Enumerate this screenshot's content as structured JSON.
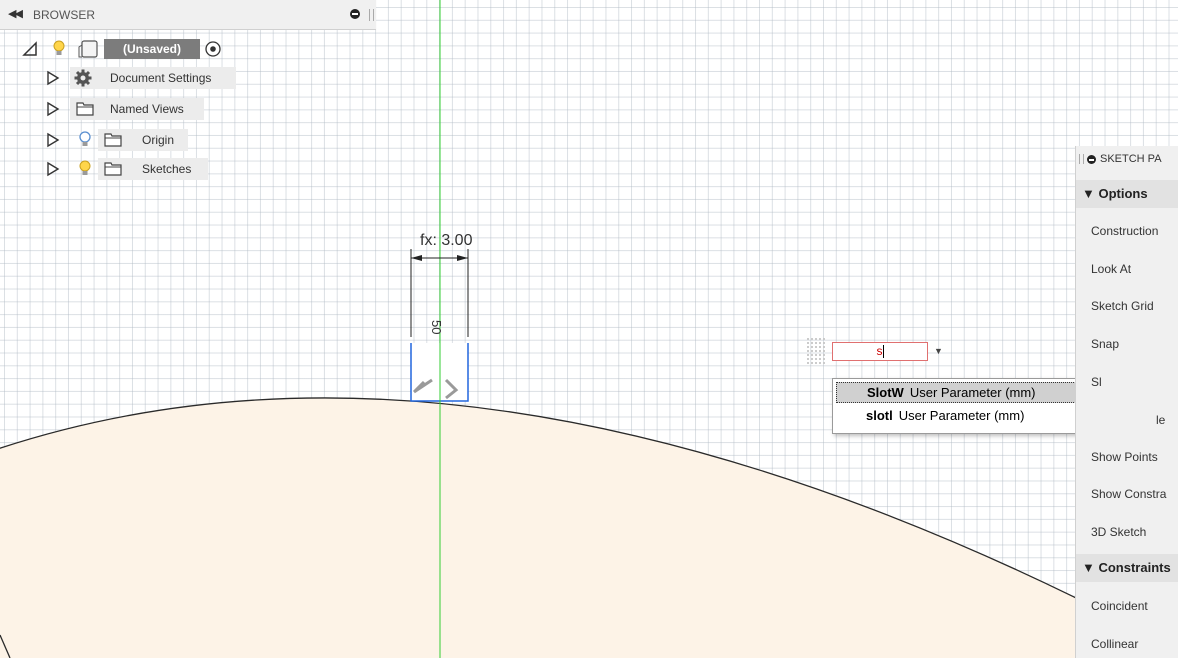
{
  "browser": {
    "title": "BROWSER",
    "collapse_glyph": "◀◀",
    "root": {
      "label": "(Unsaved)"
    },
    "items": [
      {
        "label": "Document Settings",
        "icon": "gear-icon"
      },
      {
        "label": "Named Views",
        "icon": "folder-icon"
      },
      {
        "label": "Origin",
        "icon": "folder-icon",
        "bulb": "off"
      },
      {
        "label": "Sketches",
        "icon": "folder-icon",
        "bulb": "on"
      }
    ]
  },
  "canvas": {
    "dimension_label": "fx: 3.00",
    "vertical_dimension": "50",
    "profile_fill": "#fdf3e7",
    "axis_color": "#33cc33",
    "slot_color": "#2266dd"
  },
  "expression": {
    "value": "s",
    "dropdown_arrow": "▼"
  },
  "autocomplete": [
    {
      "name": "SlotW",
      "desc": "User Parameter (mm)",
      "selected": true
    },
    {
      "name": "slotl",
      "desc": "User Parameter (mm)",
      "selected": false
    }
  ],
  "palette": {
    "title": "SKETCH PA",
    "sections": [
      {
        "label": "▼ Options"
      },
      {
        "label": "▼ Constraints"
      }
    ],
    "options": [
      "Construction",
      "Look At",
      "Sketch Grid",
      "Snap",
      "Sl",
      "le",
      "Show Points",
      "Show Constra",
      "3D Sketch"
    ],
    "constraints": [
      "Coincident",
      "Collinear"
    ]
  }
}
